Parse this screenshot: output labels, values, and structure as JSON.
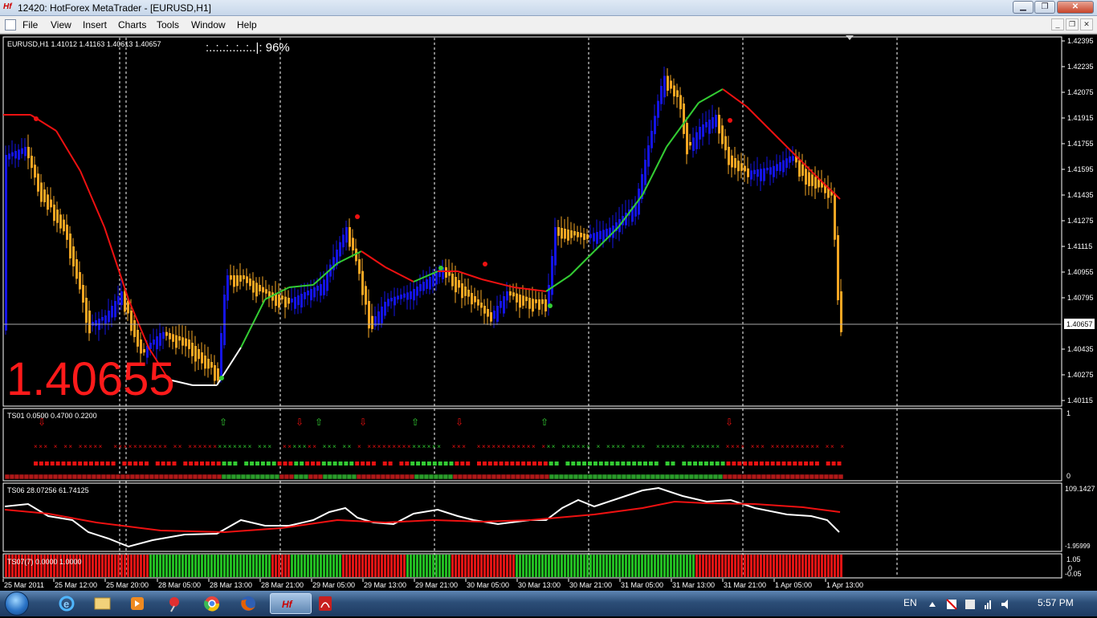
{
  "window": {
    "title": "12420: HotForex MetaTrader - [EURUSD,H1]",
    "logo_text": "Hf",
    "minimize_glyph": "▁",
    "restore_glyph": "❐",
    "close_glyph": "✕"
  },
  "menu": {
    "items": [
      "File",
      "View",
      "Insert",
      "Charts",
      "Tools",
      "Window",
      "Help"
    ],
    "mdi_minimize": "_",
    "mdi_restore": "❐",
    "mdi_close": "✕"
  },
  "chart": {
    "symbol_info": "EURUSD,H1  1.41012 1.41163 1.40613 1.40657",
    "progress_label": ":..:..:..:..:..|:  96%",
    "progress_percent": 96,
    "big_price": "1.40655",
    "current_price_label": "1.40657",
    "price_axis": [
      "1.42395",
      "1.42235",
      "1.42075",
      "1.41915",
      "1.41755",
      "1.41595",
      "1.41435",
      "1.41275",
      "1.41115",
      "1.40955",
      "1.40795",
      "1.40435",
      "1.40275",
      "1.40115"
    ],
    "time_axis": [
      "25 Mar 2011",
      "25 Mar 12:00",
      "25 Mar 20:00",
      "28 Mar 05:00",
      "28 Mar 13:00",
      "28 Mar 21:00",
      "29 Mar 05:00",
      "29 Mar 13:00",
      "29 Mar 21:00",
      "30 Mar 05:00",
      "30 Mar 13:00",
      "30 Mar 21:00",
      "31 Mar 05:00",
      "31 Mar 13:00",
      "31 Mar 21:00",
      "1 Apr 05:00",
      "1 Apr 13:00"
    ],
    "colors": {
      "bull": "#1414e6",
      "bear": "#f5a623",
      "ma_up": "#33cc33",
      "ma_down": "#ee1111",
      "grid": "#ffffff",
      "price_text": "#ff1a1a"
    }
  },
  "indicators": {
    "ts01": {
      "label": "TS01 0.0500 0.4700 0.2200",
      "axis_top": "1",
      "axis_bottom": "0"
    },
    "ts06": {
      "label": "TS06 28.07256 61.74125",
      "axis_top": "109.1427",
      "axis_bottom": "-1.95999"
    },
    "ts07": {
      "label": "TS07(7) 0.0000 1.0000",
      "axis_top": "1.05",
      "axis_mid": "0",
      "axis_bottom": "-0.05"
    }
  },
  "taskbar": {
    "language": "EN",
    "time": "5:57 PM",
    "apps": [
      "internet-explorer",
      "file-explorer",
      "media-player",
      "app-pin",
      "chrome",
      "firefox",
      "hotforex-metatrader",
      "acrobat-reader"
    ]
  }
}
